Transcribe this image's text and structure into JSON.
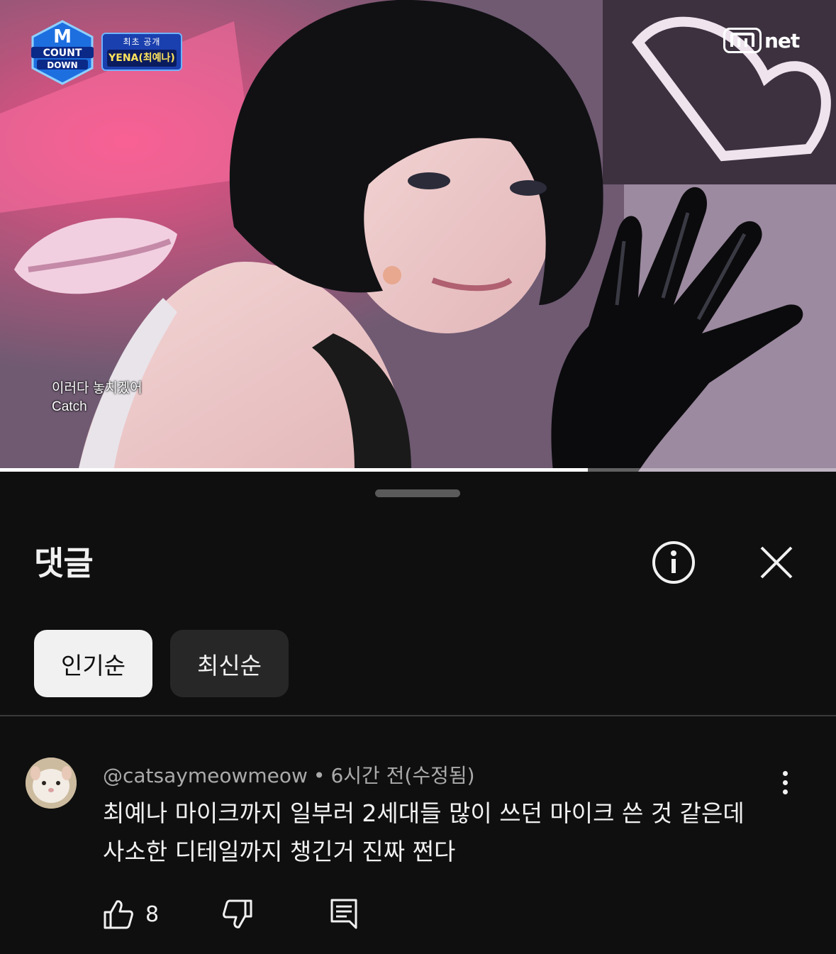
{
  "video": {
    "progress_fraction": 0.703,
    "badge_top": "최초 공개",
    "badge_bottom": "YENA(최예나)",
    "show_logo_text": [
      "COUNT",
      "DOWN"
    ],
    "broadcaster_logo_text": "net",
    "subtitle_line1": "이러다 놓치겠어",
    "subtitle_line2": "Catch"
  },
  "sheet": {
    "title": "댓글",
    "info_icon": "info-icon",
    "close_icon": "close-icon",
    "sort_chips": [
      {
        "label": "인기순",
        "active": true
      },
      {
        "label": "최신순",
        "active": false
      }
    ]
  },
  "comment": {
    "author": "@catsaymeowmeow",
    "separator": "•",
    "time": "6시간 전(수정됨)",
    "text_line1": "최예나 마이크까지 일부러 2세대들 많이 쓰던 마이크 쓴 것 같은데",
    "text_line2": "사소한 디테일까지 챙긴거 진짜 쩐다",
    "like_count": "8",
    "icons": [
      "thumb-up-icon",
      "thumb-down-icon",
      "reply-icon",
      "more-vert-icon"
    ]
  },
  "colors": {
    "background": "#0f0f0f",
    "text_primary": "#f1f1f1",
    "text_secondary": "#aaaaaa",
    "chip_active_bg": "#f1f1f1",
    "chip_inactive_bg": "#272727"
  }
}
